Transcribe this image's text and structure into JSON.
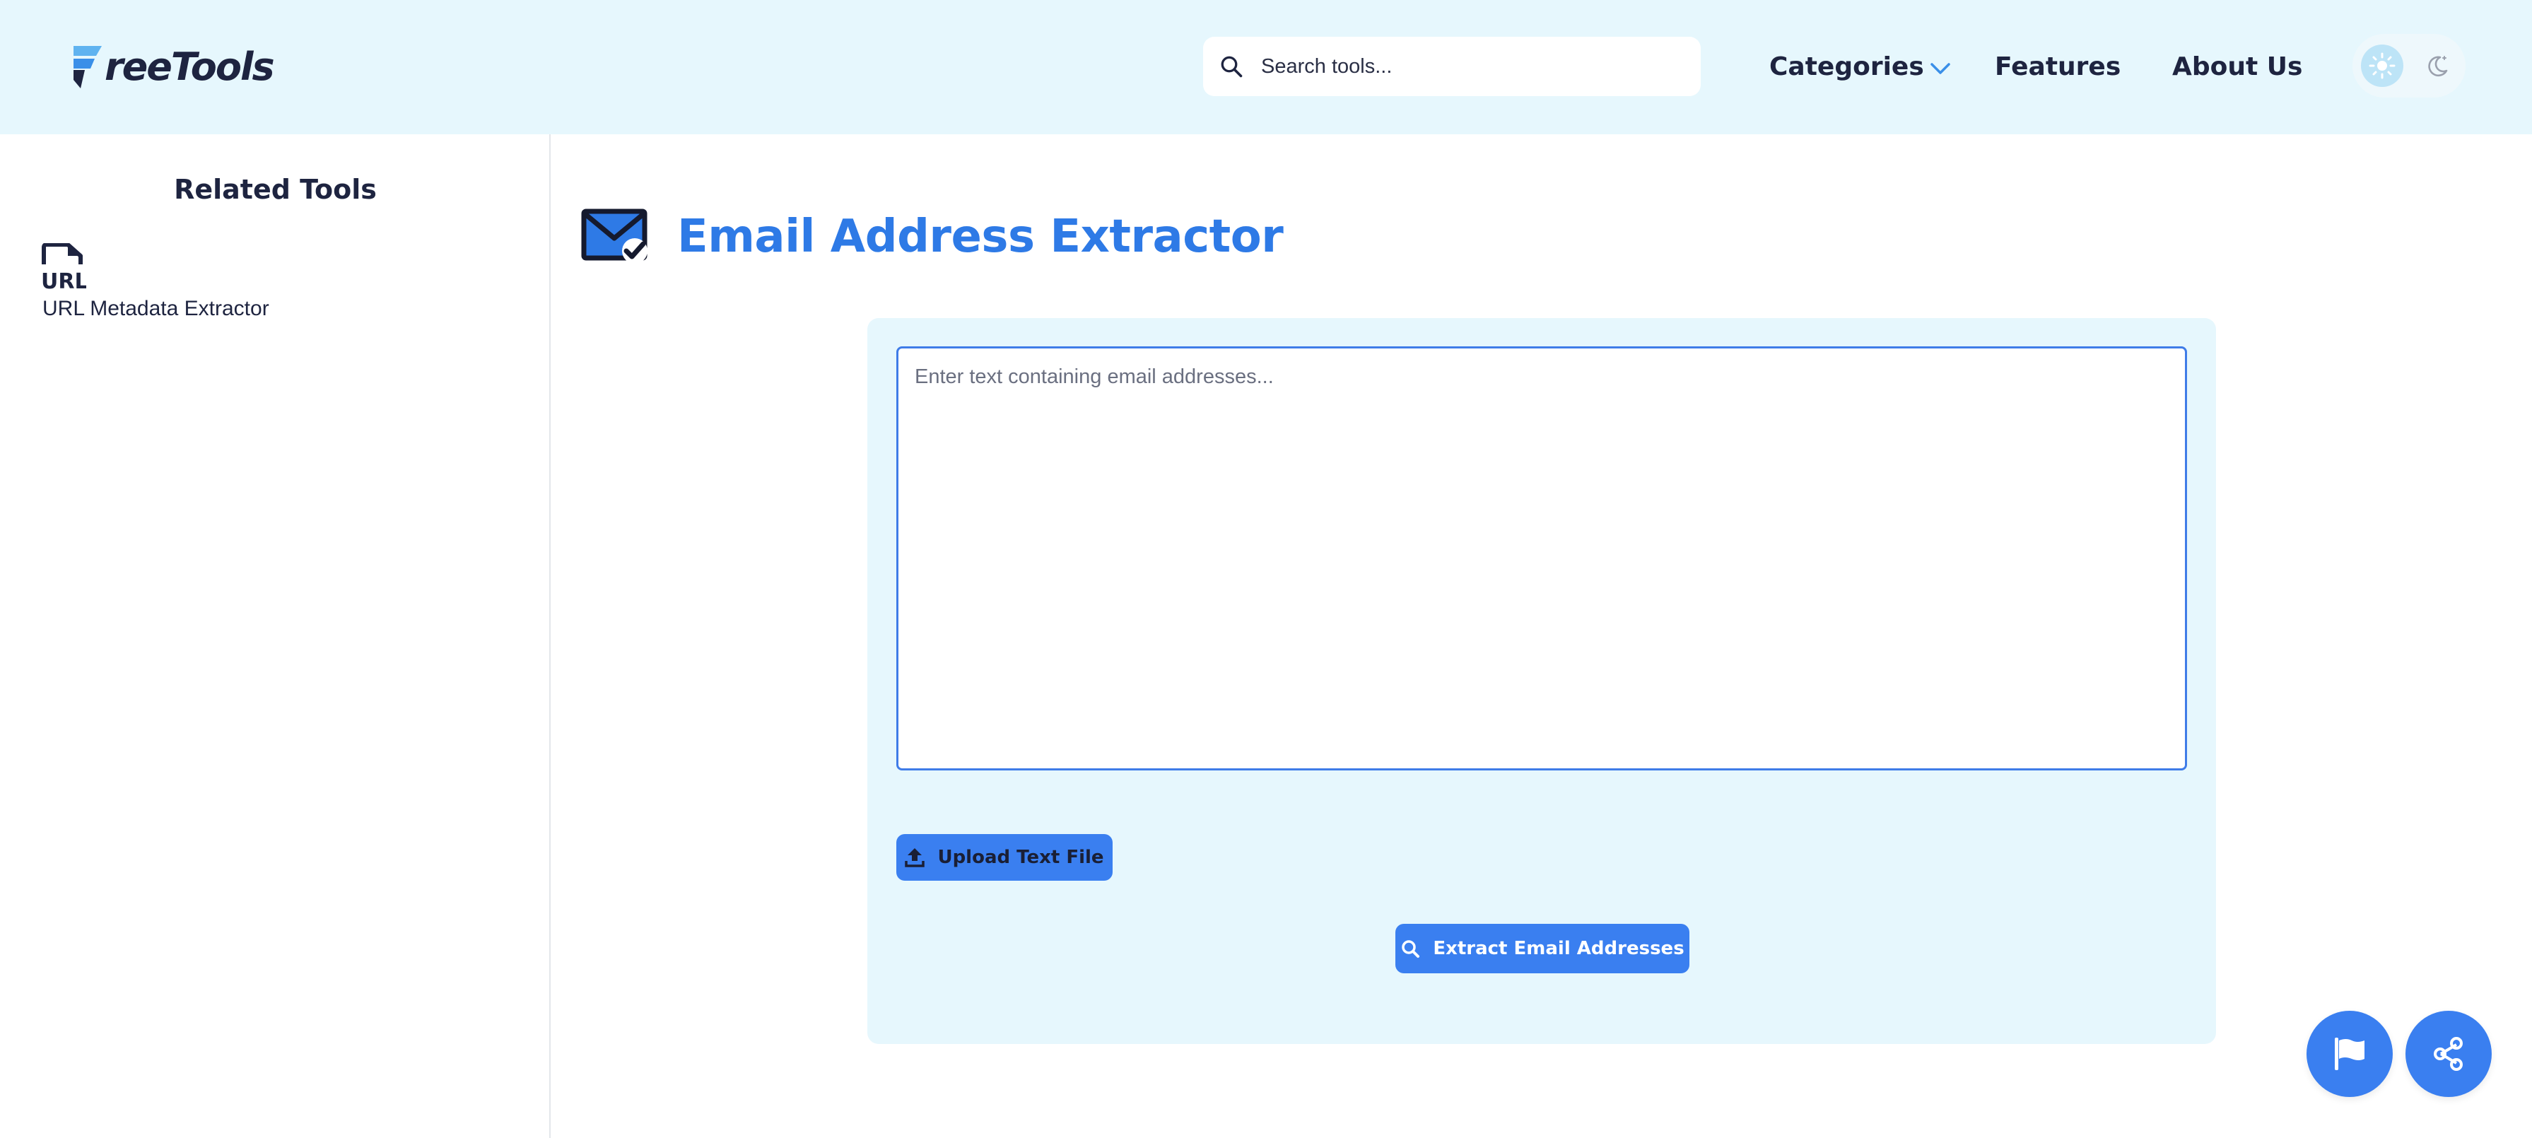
{
  "brand": {
    "name": "reeTools"
  },
  "search": {
    "placeholder": "Search tools..."
  },
  "nav": {
    "categories": "Categories",
    "features": "Features",
    "about": "About Us"
  },
  "sidebar": {
    "title": "Related Tools",
    "items": [
      {
        "icon": "url-file-icon",
        "label": "URL Metadata Extractor"
      }
    ]
  },
  "tool": {
    "icon": "email-check-icon",
    "title": "Email Address Extractor",
    "input_placeholder": "Enter text containing email addresses...",
    "input_value": "",
    "upload_label": "Upload Text File",
    "extract_label": "Extract Email Addresses"
  },
  "colors": {
    "accent": "#3a7ff0",
    "title": "#2e7ae6",
    "header_bg": "#e6f7fd",
    "text_dark": "#1e2440"
  }
}
